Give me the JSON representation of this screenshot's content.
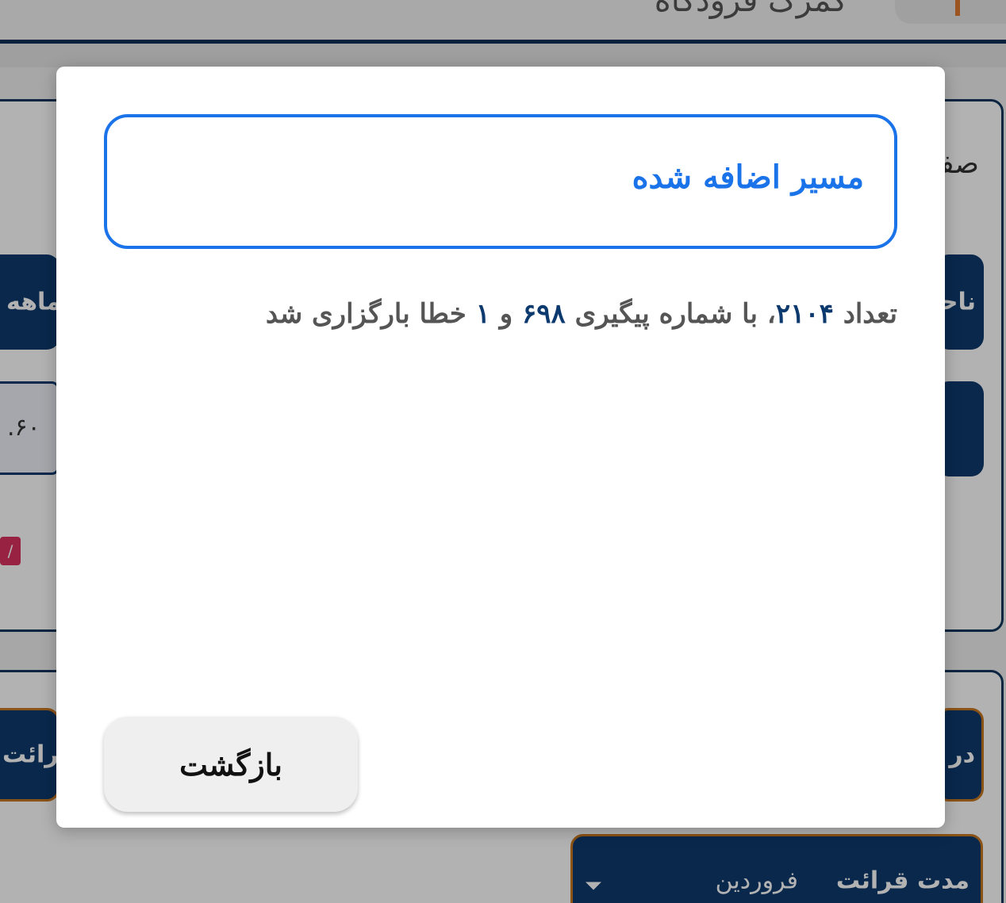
{
  "background": {
    "header_title": "گمرک فرودگاه",
    "card_label": "صفحه",
    "pill_1_left": "ماهه",
    "pill_1_right": "ناحیه",
    "input_value": ".۶۰",
    "pill_2_left": "ر قرائت",
    "pill_2_right": "در",
    "pill_3_label": "مدت قرائت",
    "pill_3_value": "فروردین",
    "accent_colors": {
      "navy": "#0d3a6e",
      "orange": "#c7771f",
      "pink": "#d8325f"
    }
  },
  "modal": {
    "title": "مسیر اضافه شده",
    "message": {
      "part1": "تعداد ",
      "count": "۲۱۰۴",
      "part2": "، با شماره پیگیری ",
      "tracking": "۶۹۸",
      "part3": " و ",
      "errors": "۱",
      "part4": " خطا بارگزاری شد"
    },
    "back_label": "بازگشت",
    "accent_color": "#1a73e8"
  }
}
